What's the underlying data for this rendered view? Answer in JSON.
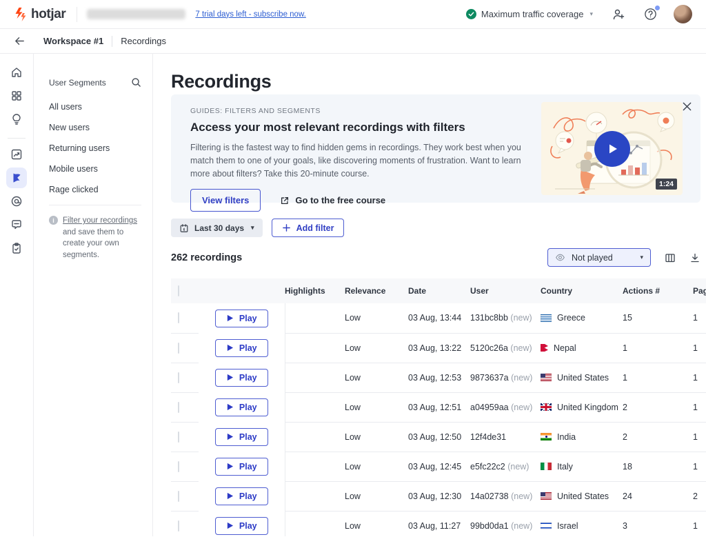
{
  "header": {
    "brand": "hotjar",
    "trial_link": "7 trial days left - subscribe now.",
    "traffic_status": "Maximum traffic coverage"
  },
  "breadcrumb": {
    "workspace": "Workspace #1",
    "page": "Recordings"
  },
  "sidebar": {
    "title": "User Segments",
    "items": [
      "All users",
      "New users",
      "Returning users",
      "Mobile users",
      "Rage clicked"
    ],
    "tip_link": "Filter your recordings",
    "tip_text": " and save them to create your own segments."
  },
  "main": {
    "title": "Recordings",
    "banner": {
      "eyebrow": "GUIDES: FILTERS AND SEGMENTS",
      "title": "Access your most relevant recordings with filters",
      "body": "Filtering is the fastest way to find hidden gems in recordings. They work best when you match them to one of your goals, like discovering moments of frustration. Want to learn more about filters? Take this 20-minute course.",
      "primary_button": "View filters",
      "course_link": "Go to the free course",
      "video_duration": "1:24"
    },
    "filters": {
      "date_range": "Last 30 days",
      "add_filter": "Add filter"
    },
    "results_count": "262 recordings",
    "played_filter": "Not played",
    "table": {
      "columns": [
        "Highlights",
        "Relevance",
        "Date",
        "User",
        "Country",
        "Actions #",
        "Page"
      ],
      "play_label": "Play",
      "new_label": "(new)",
      "rows": [
        {
          "relevance": "Low",
          "date": "03 Aug, 13:44",
          "user": "131bc8bb",
          "new": true,
          "country": "Greece",
          "flag": "gr",
          "actions": "15",
          "pages": "1"
        },
        {
          "relevance": "Low",
          "date": "03 Aug, 13:22",
          "user": "5120c26a",
          "new": true,
          "country": "Nepal",
          "flag": "np",
          "actions": "1",
          "pages": "1"
        },
        {
          "relevance": "Low",
          "date": "03 Aug, 12:53",
          "user": "9873637a",
          "new": true,
          "country": "United States",
          "flag": "us",
          "actions": "1",
          "pages": "1"
        },
        {
          "relevance": "Low",
          "date": "03 Aug, 12:51",
          "user": "a04959aa",
          "new": true,
          "country": "United Kingdom",
          "flag": "gb",
          "actions": "2",
          "pages": "1"
        },
        {
          "relevance": "Low",
          "date": "03 Aug, 12:50",
          "user": "12f4de31",
          "new": false,
          "country": "India",
          "flag": "in",
          "actions": "2",
          "pages": "1"
        },
        {
          "relevance": "Low",
          "date": "03 Aug, 12:45",
          "user": "e5fc22c2",
          "new": true,
          "country": "Italy",
          "flag": "it",
          "actions": "18",
          "pages": "1"
        },
        {
          "relevance": "Low",
          "date": "03 Aug, 12:30",
          "user": "14a02738",
          "new": true,
          "country": "United States",
          "flag": "us",
          "actions": "24",
          "pages": "2"
        },
        {
          "relevance": "Low",
          "date": "03 Aug, 11:27",
          "user": "99bd0da1",
          "new": true,
          "country": "Israel",
          "flag": "il",
          "actions": "3",
          "pages": "1"
        }
      ]
    }
  },
  "colors": {
    "brand_orange": "#ff4715",
    "accent_blue": "#3240c4",
    "success_green": "#0e8a61",
    "banner_bg": "#f3f6fa",
    "thumb_bg": "#fbf5e6"
  }
}
